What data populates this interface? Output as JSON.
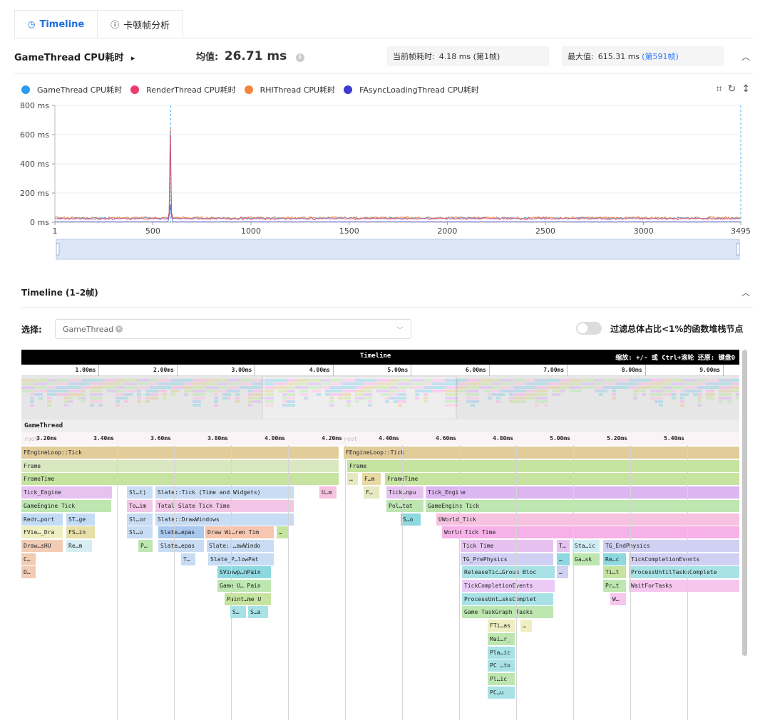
{
  "tabs": [
    {
      "label": "Timeline",
      "icon": "clock-icon"
    },
    {
      "label": "卡顿帧分析",
      "icon": "info-circle-icon"
    }
  ],
  "summary": {
    "title": "GameThread CPU耗时",
    "title_arrow": "▸",
    "avg_label": "均值:",
    "avg_value": "26.71 ms",
    "current_label": "当前帧耗时:",
    "current_value": "4.18 ms (第1帧)",
    "max_label": "最大值:",
    "max_value": "615.31 ms",
    "max_link": "(第591帧)"
  },
  "legend": [
    {
      "name": "GameThread CPU耗时",
      "color": "#2d9cf0"
    },
    {
      "name": "RenderThread CPU耗时",
      "color": "#ee3a6a"
    },
    {
      "name": "RHIThread CPU耗时",
      "color": "#f2843b"
    },
    {
      "name": "FAsyncLoadingThread CPU耗时",
      "color": "#3e3ccf"
    }
  ],
  "chart_data": {
    "type": "line",
    "x_ticks": [
      "1",
      "500",
      "1000",
      "1500",
      "2000",
      "2500",
      "3000",
      "3495"
    ],
    "y_ticks": [
      "800 ms",
      "600 ms",
      "400 ms",
      "200 ms",
      "0 ms"
    ],
    "ylim": [
      0,
      800
    ],
    "xlim": [
      1,
      3495
    ],
    "series": [
      {
        "name": "GameThread CPU耗时",
        "baseline": 26.71,
        "peak_x": 591,
        "peak_y": 615.31
      },
      {
        "name": "RenderThread CPU耗时",
        "baseline": 24,
        "peak_x": 591,
        "peak_y": 600
      },
      {
        "name": "RHIThread CPU耗时",
        "baseline": 30,
        "peak_x": 591,
        "peak_y": 640
      },
      {
        "name": "FAsyncLoadingThread CPU耗时",
        "baseline": 2,
        "peak_x": 591,
        "peak_y": 120
      }
    ],
    "marker_x": [
      591,
      3495
    ]
  },
  "timeline": {
    "title": "Timeline (1–2帧)",
    "select_label": "选择:",
    "select_value": "GameThread",
    "filter_label": "过滤总体占比<1%的函数堆栈节点",
    "bar_title": "Timeline",
    "bar_hint": "缩放: +/- 或 Ctrl+滚轮   还原: 键盘0",
    "top_ticks": [
      "1.00ms",
      "2.00ms",
      "3.00ms",
      "4.00ms",
      "5.00ms",
      "6.00ms",
      "7.00ms",
      "8.00ms",
      "9.00ms"
    ],
    "thread": "GameThread",
    "sub_ticks": [
      "3.20ms",
      "3.40ms",
      "3.60ms",
      "3.80ms",
      "4.00ms",
      "4.20ms",
      "4.40ms",
      "4.60ms",
      "4.80ms",
      "5.00ms",
      "5.20ms",
      "5.40ms"
    ],
    "root_label": "root",
    "nodes": [
      {
        "t": "FEngineLoop::Tick",
        "row": 0,
        "x": 0,
        "w": 445,
        "c": "#e2cc9a"
      },
      {
        "t": "FEngineLoop::Tick",
        "row": 0,
        "x": 452,
        "w": 555,
        "c": "#e2cc9a"
      },
      {
        "t": "Frame",
        "row": 1,
        "x": 0,
        "w": 445,
        "c": "#d9e8c0"
      },
      {
        "t": "Frame",
        "row": 1,
        "x": 457,
        "w": 550,
        "c": "#c6e3a0"
      },
      {
        "t": "FrameTime",
        "row": 2,
        "x": 0,
        "w": 445,
        "c": "#c6e3a0"
      },
      {
        "t": "…",
        "row": 2,
        "x": 457,
        "w": 15,
        "c": "#e6e8c0"
      },
      {
        "t": "F…m",
        "row": 2,
        "x": 478,
        "w": 26,
        "c": "#e8d8a4"
      },
      {
        "t": "FrameTime",
        "row": 2,
        "x": 510,
        "w": 497,
        "c": "#c6e3a0"
      },
      {
        "t": "Tick_Engine",
        "row": 3,
        "x": 0,
        "w": 127,
        "c": "#e6c2f0"
      },
      {
        "t": "Sl…t)",
        "row": 3,
        "x": 148,
        "w": 36,
        "c": "#c8dcf4"
      },
      {
        "t": "Slate::Tick (Time and Widgets)",
        "row": 3,
        "x": 188,
        "w": 194,
        "c": "#c8dcf4"
      },
      {
        "t": "U…m",
        "row": 3,
        "x": 418,
        "w": 24,
        "c": "#f6c2e0"
      },
      {
        "t": "F…",
        "row": 3,
        "x": 480,
        "w": 22,
        "c": "#e6e8c0"
      },
      {
        "t": "Tick…npu",
        "row": 3,
        "x": 512,
        "w": 52,
        "c": "#e6c2f0"
      },
      {
        "t": "Tick_Engine",
        "row": 3,
        "x": 567,
        "w": 440,
        "c": "#dcb6f0"
      },
      {
        "t": "GameEngine Tick",
        "row": 4,
        "x": 0,
        "w": 126,
        "c": "#bde6b0"
      },
      {
        "t": "To…im",
        "row": 4,
        "x": 148,
        "w": 36,
        "c": "#f2c6e6"
      },
      {
        "t": "Total Slate Tick Time",
        "row": 4,
        "x": 188,
        "w": 194,
        "c": "#f2c6e6"
      },
      {
        "t": "Pol…tat",
        "row": 4,
        "x": 512,
        "w": 52,
        "c": "#bde6b0"
      },
      {
        "t": "GameEngine Tick",
        "row": 4,
        "x": 567,
        "w": 440,
        "c": "#bde6b0"
      },
      {
        "t": "Redr…port",
        "row": 5,
        "x": 0,
        "w": 58,
        "c": "#c2dcf6"
      },
      {
        "t": "ST…ge",
        "row": 5,
        "x": 63,
        "w": 40,
        "c": "#c2dcf6"
      },
      {
        "t": "Sl…or",
        "row": 5,
        "x": 148,
        "w": 36,
        "c": "#c8dcf4"
      },
      {
        "t": "Slate::DrawWindows",
        "row": 5,
        "x": 188,
        "w": 194,
        "c": "#c8dcf4"
      },
      {
        "t": "S…o",
        "row": 5,
        "x": 532,
        "w": 28,
        "c": "#8ed8e0"
      },
      {
        "t": "UWorld_Tick",
        "row": 5,
        "x": 582,
        "w": 425,
        "c": "#f6c2e0"
      },
      {
        "t": "FVie…_Dra",
        "row": 6,
        "x": 0,
        "w": 58,
        "c": "#eeeec0"
      },
      {
        "t": "FS…in",
        "row": 6,
        "x": 63,
        "w": 40,
        "c": "#e6e0a6"
      },
      {
        "t": "Sl…u",
        "row": 6,
        "x": 148,
        "w": 36,
        "c": "#c8dcf4"
      },
      {
        "t": "Slate…epas",
        "row": 6,
        "x": 192,
        "w": 64,
        "c": "#a8c8ee"
      },
      {
        "t": "Draw Wi…ren Tim",
        "row": 6,
        "x": 258,
        "w": 96,
        "c": "#f6c6b0"
      },
      {
        "t": "…",
        "row": 6,
        "x": 358,
        "w": 16,
        "c": "#c6e3a0"
      },
      {
        "t": "World Tick Time",
        "row": 6,
        "x": 590,
        "w": 417,
        "c": "#f6b2e8"
      },
      {
        "t": "Draw…sHU",
        "row": 7,
        "x": 0,
        "w": 58,
        "c": "#f2ccb4"
      },
      {
        "t": "Re…m",
        "row": 7,
        "x": 63,
        "w": 36,
        "c": "#d6eef2"
      },
      {
        "t": "P…",
        "row": 7,
        "x": 164,
        "w": 20,
        "c": "#bde6b0"
      },
      {
        "t": "Slate…epas",
        "row": 7,
        "x": 192,
        "w": 64,
        "c": "#c8dcf4"
      },
      {
        "t": "Slate::…awWindo",
        "row": 7,
        "x": 260,
        "w": 94,
        "c": "#c8dcf4"
      },
      {
        "t": "Tick Time",
        "row": 7,
        "x": 616,
        "w": 130,
        "c": "#e6c2f0"
      },
      {
        "t": "T…",
        "row": 7,
        "x": 751,
        "w": 18,
        "c": "#e6c2f0"
      },
      {
        "t": "Sta…ic",
        "row": 7,
        "x": 773,
        "w": 38,
        "c": "#d2ecf4"
      },
      {
        "t": "TG_EndPhysics",
        "row": 7,
        "x": 816,
        "w": 191,
        "c": "#d0d0f4"
      },
      {
        "t": "C…",
        "row": 8,
        "x": 0,
        "w": 20,
        "c": "#f2ccb4"
      },
      {
        "t": "T…",
        "row": 8,
        "x": 224,
        "w": 20,
        "c": "#c8dcf4"
      },
      {
        "t": "Slate_P…lowPat",
        "row": 8,
        "x": 262,
        "w": 92,
        "c": "#c8dcf4"
      },
      {
        "t": "TG_PrePhysics",
        "row": 8,
        "x": 616,
        "w": 130,
        "c": "#d0d0f4"
      },
      {
        "t": "…",
        "row": 8,
        "x": 751,
        "w": 18,
        "c": "#8ed8e0"
      },
      {
        "t": "Ga…sk",
        "row": 8,
        "x": 773,
        "w": 38,
        "c": "#bde6b0"
      },
      {
        "t": "Re…c",
        "row": 8,
        "x": 816,
        "w": 32,
        "c": "#8ed8e0"
      },
      {
        "t": "TickCompletionEvents",
        "row": 8,
        "x": 852,
        "w": 155,
        "c": "#d0d0f4"
      },
      {
        "t": "D…",
        "row": 9,
        "x": 0,
        "w": 20,
        "c": "#f2ccb4"
      },
      {
        "t": "SViewp…nPain",
        "row": 9,
        "x": 275,
        "w": 75,
        "c": "#8ed8e0"
      },
      {
        "t": "ReleaseTic…Group Bloc",
        "row": 9,
        "x": 618,
        "w": 130,
        "c": "#a8e2e6"
      },
      {
        "t": "…",
        "row": 9,
        "x": 751,
        "w": 16,
        "c": "#d0d0f4"
      },
      {
        "t": "Ti…t",
        "row": 9,
        "x": 816,
        "w": 32,
        "c": "#c6e3a0"
      },
      {
        "t": "ProcessUntilTasksComplete",
        "row": 9,
        "x": 852,
        "w": 155,
        "c": "#a8e2e6"
      },
      {
        "t": "Game U… Pain",
        "row": 10,
        "x": 275,
        "w": 75,
        "c": "#bde6b0"
      },
      {
        "t": "TickCompletionEvents",
        "row": 10,
        "x": 618,
        "w": 130,
        "c": "#eccaf6"
      },
      {
        "t": "Pr…t",
        "row": 10,
        "x": 816,
        "w": 32,
        "c": "#bde6b0"
      },
      {
        "t": "WaitForTasks",
        "row": 10,
        "x": 852,
        "w": 155,
        "c": "#f6c6ee"
      },
      {
        "t": "Paint…me U",
        "row": 11,
        "x": 285,
        "w": 65,
        "c": "#c6e3a0"
      },
      {
        "t": "ProcessUnt…sksComplet",
        "row": 11,
        "x": 618,
        "w": 128,
        "c": "#a8e2e6"
      },
      {
        "t": "W…",
        "row": 11,
        "x": 826,
        "w": 22,
        "c": "#f6c6ee"
      },
      {
        "t": "S…",
        "row": 12,
        "x": 293,
        "w": 22,
        "c": "#a8e2e6"
      },
      {
        "t": "S…a",
        "row": 12,
        "x": 318,
        "w": 28,
        "c": "#a8e2e6"
      },
      {
        "t": "Game TaskGraph Tasks",
        "row": 12,
        "x": 618,
        "w": 128,
        "c": "#bde6b0"
      },
      {
        "t": "FTi…as",
        "row": 13,
        "x": 654,
        "w": 38,
        "c": "#eeeec0"
      },
      {
        "t": "…",
        "row": 13,
        "x": 700,
        "w": 16,
        "c": "#eeeec0"
      },
      {
        "t": "Mai…r_",
        "row": 14,
        "x": 654,
        "w": 38,
        "c": "#bde6b0"
      },
      {
        "t": "Pla…ic",
        "row": 15,
        "x": 654,
        "w": 38,
        "c": "#a8e2e6"
      },
      {
        "t": "PC …to",
        "row": 16,
        "x": 654,
        "w": 38,
        "c": "#a8e2e6"
      },
      {
        "t": "Pl…ic",
        "row": 17,
        "x": 654,
        "w": 38,
        "c": "#bde6b0"
      },
      {
        "t": "PC…u",
        "row": 18,
        "x": 654,
        "w": 38,
        "c": "#a8e2e6"
      }
    ]
  }
}
